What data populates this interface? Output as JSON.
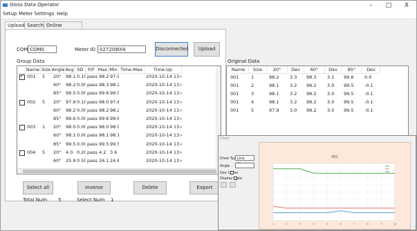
{
  "window": {
    "title": "Gloss Data Operator",
    "controls": [
      "–",
      "□",
      "X"
    ]
  },
  "menu": [
    "Setup",
    "Meter Settings",
    "Help"
  ],
  "tabs": [
    "Upload",
    "Search",
    "Online Measurement"
  ],
  "form": {
    "com_label": "COM",
    "com_value": "COM0",
    "meter_label": "Meter ID",
    "meter_value": "0272090l4",
    "disconnect_button": "Disconnected",
    "upload_button": "Upload"
  },
  "group": {
    "label": "Group Data",
    "headers": [
      "",
      "Name",
      "Size",
      "Angle",
      "Avg",
      "SD",
      "P/F",
      "Max",
      "Min",
      "Time-Mea",
      "Time-Up"
    ],
    "rows": [
      {
        "check": true,
        "name": "001",
        "size": "5",
        "angle": "20°",
        "avg": "98.1",
        "sd": "0.10",
        "pf": "pass",
        "max": "98.2",
        "min": "97.9",
        "time_mea": "",
        "time_up": "2020-10-14 13:46:3"
      },
      {
        "check": null,
        "name": "",
        "size": "",
        "angle": "60°",
        "avg": "98.2",
        "sd": "0.00",
        "pf": "pass",
        "max": "98.3",
        "min": "98.2",
        "time_mea": "",
        "time_up": "2020-10-14 13:46:3"
      },
      {
        "check": null,
        "name": "",
        "size": "",
        "angle": "85°",
        "avg": "99.5",
        "sd": "0.00",
        "pf": "pass",
        "max": "99.6",
        "min": "99.5",
        "time_mea": "",
        "time_up": "2020-10-14 13:46:3"
      },
      {
        "check": false,
        "name": "002",
        "size": "5",
        "angle": "20°",
        "avg": "97.9",
        "sd": "0.10",
        "pf": "pass",
        "max": "98.0",
        "min": "97.8",
        "time_mea": "",
        "time_up": "2020-10-14 13:46:3"
      },
      {
        "check": null,
        "name": "",
        "size": "",
        "angle": "60°",
        "avg": "98.2",
        "sd": "0.00",
        "pf": "pass",
        "max": "98.2",
        "min": "98.2",
        "time_mea": "",
        "time_up": "2020-10-14 13:46:3"
      },
      {
        "check": null,
        "name": "",
        "size": "",
        "angle": "85°",
        "avg": "99.6",
        "sd": "0.00",
        "pf": "pass",
        "max": "99.6",
        "min": "99.6",
        "time_mea": "",
        "time_up": "2020-10-14 13:46:3"
      },
      {
        "check": false,
        "name": "003",
        "size": "1",
        "angle": "20°",
        "avg": "98.0",
        "sd": "0.00",
        "pf": "pass",
        "max": "98.0",
        "min": "98.0",
        "time_mea": "",
        "time_up": "2020-10-14 13:46:3"
      },
      {
        "check": null,
        "name": "",
        "size": "",
        "angle": "60°",
        "avg": "98.1",
        "sd": "0.00",
        "pf": "pass",
        "max": "98.1",
        "min": "98.1",
        "time_mea": "",
        "time_up": "2020-10-14 13:46:3"
      },
      {
        "check": null,
        "name": "",
        "size": "",
        "angle": "85°",
        "avg": "99.5",
        "sd": "0.00",
        "pf": "pass",
        "max": "99.5",
        "min": "99.5",
        "time_mea": "",
        "time_up": "2020-10-14 13:46:3"
      },
      {
        "check": false,
        "name": "004",
        "size": "5",
        "angle": "20°",
        "avg": "4.0",
        "sd": "0.20",
        "pf": "pass",
        "max": "4.2",
        "min": "3.6",
        "time_mea": "",
        "time_up": "2020-10-14 13:46:3"
      },
      {
        "check": null,
        "name": "",
        "size": "",
        "angle": "60°",
        "avg": "25.9",
        "sd": "0.50",
        "pf": "pass",
        "max": "26.1",
        "min": "24.8",
        "time_mea": "",
        "time_up": "2020-10-14 13:46:3"
      }
    ]
  },
  "original": {
    "label": "Original Data",
    "headers": [
      "Name",
      "Size",
      "20°",
      "Dev",
      "60°",
      "Dev",
      "85°",
      "Dev"
    ],
    "rows": [
      [
        "001",
        "1",
        "98.2",
        "3.3",
        "98.3",
        "3.1",
        "99.6",
        "0.0"
      ],
      [
        "001",
        "2",
        "98.1",
        "3.2",
        "98.2",
        "3.0",
        "99.5",
        "-0.1"
      ],
      [
        "001",
        "3",
        "98.1",
        "3.2",
        "98.2",
        "3.0",
        "99.5",
        "-0.1"
      ],
      [
        "001",
        "4",
        "98.1",
        "3.2",
        "98.2",
        "3.0",
        "99.5",
        "-0.1"
      ],
      [
        "001",
        "5",
        "97.9",
        "3.0",
        "98.2",
        "3.0",
        "99.5",
        "-0.1"
      ]
    ]
  },
  "buttons": {
    "select_all": "Select all",
    "inverse": "Inverse",
    "delete": "Delete",
    "export": "Export"
  },
  "footer": {
    "total_label": "Total Num",
    "total_value": "5",
    "select_label": "Select Num",
    "select_value": "1"
  },
  "popup": {
    "title": "Chart",
    "fields": [
      "Draw Type",
      "Angle",
      "Dev Curve",
      "Display Data"
    ],
    "draw_type_value": "Line Chart",
    "chart_data": {
      "type": "line",
      "title": "001",
      "x": [
        1,
        2,
        3,
        4,
        5,
        6,
        7,
        8,
        9,
        10
      ],
      "series": [
        {
          "values": [
            99.0,
            99.0,
            99.0,
            96.5,
            96.5,
            96.5,
            96.5,
            96.5,
            96.5,
            96.5
          ],
          "color": "#4caf50"
        },
        {
          "values": [
            78.0,
            77.0,
            77.0,
            77.0,
            77.0,
            77.0,
            77.0,
            77.0,
            77.0,
            77.0
          ],
          "color": "#e57373"
        },
        {
          "values": [
            74.5,
            74.5,
            74.5,
            74.5,
            74.5,
            75.5,
            74.5,
            74.5,
            74.5,
            74.5
          ],
          "color": "#5b9bd5"
        }
      ],
      "ylim": [
        70,
        102
      ],
      "grid": true,
      "legend": "top-right"
    }
  }
}
